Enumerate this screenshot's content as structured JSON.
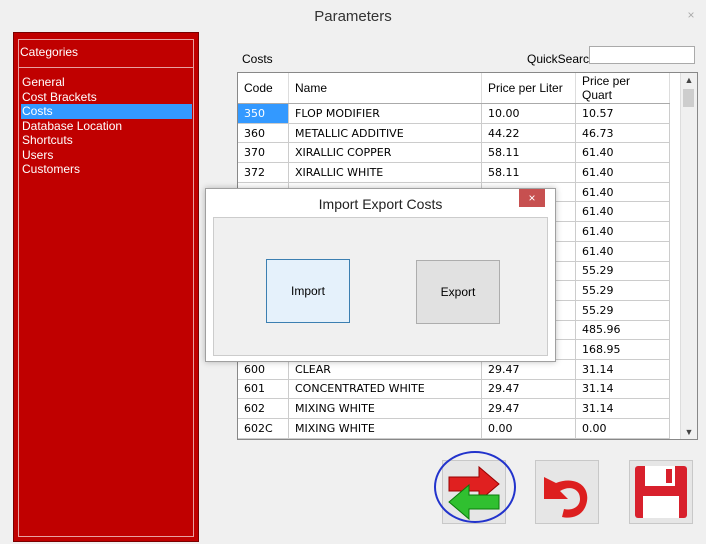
{
  "window": {
    "title": "Parameters",
    "close_glyph": "×"
  },
  "sidebar": {
    "header": "Categories",
    "items": [
      {
        "label": "General"
      },
      {
        "label": "Cost Brackets"
      },
      {
        "label": "Costs",
        "selected": true
      },
      {
        "label": "Database Location"
      },
      {
        "label": "Shortcuts"
      },
      {
        "label": "Users"
      },
      {
        "label": "Customers"
      }
    ]
  },
  "main": {
    "costs_label": "Costs",
    "quicksearch_label": "QuickSearch",
    "quicksearch_value": "",
    "table": {
      "columns": [
        "Code",
        "Name",
        "Price per Liter",
        "Price per Quart"
      ],
      "rows": [
        [
          "350",
          "FLOP MODIFIER",
          "10.00",
          "10.57"
        ],
        [
          "360",
          "METALLIC ADDITIVE",
          "44.22",
          "46.73"
        ],
        [
          "370",
          "XIRALLIC COPPER",
          "58.11",
          "61.40"
        ],
        [
          "372",
          "XIRALLIC WHITE",
          "58.11",
          "61.40"
        ],
        [
          "",
          "",
          "",
          "61.40"
        ],
        [
          "",
          "",
          "",
          "61.40"
        ],
        [
          "",
          "",
          "",
          "61.40"
        ],
        [
          "",
          "",
          "",
          "61.40"
        ],
        [
          "",
          "",
          "",
          "55.29"
        ],
        [
          "",
          "",
          "",
          "55.29"
        ],
        [
          "",
          "",
          "",
          "55.29"
        ],
        [
          "",
          "",
          "",
          "485.96"
        ],
        [
          "",
          "",
          "",
          "168.95"
        ],
        [
          "600",
          "CLEAR",
          "29.47",
          "31.14"
        ],
        [
          "601",
          "CONCENTRATED WHITE",
          "29.47",
          "31.14"
        ],
        [
          "602",
          "MIXING WHITE",
          "29.47",
          "31.14"
        ],
        [
          "602C",
          "MIXING WHITE",
          "0.00",
          "0.00"
        ]
      ],
      "highlighted_row": 0
    }
  },
  "dialog": {
    "title": "Import Export Costs",
    "close_glyph": "×",
    "import_label": "Import",
    "export_label": "Export"
  },
  "actions": {
    "import_export_icon": "import-export-arrows-icon",
    "undo_icon": "undo-arrow-icon",
    "save_icon": "floppy-disk-icon"
  },
  "colors": {
    "sidebar": "#c00000",
    "selection": "#3399ff",
    "annotation_circle": "#2233cc"
  }
}
